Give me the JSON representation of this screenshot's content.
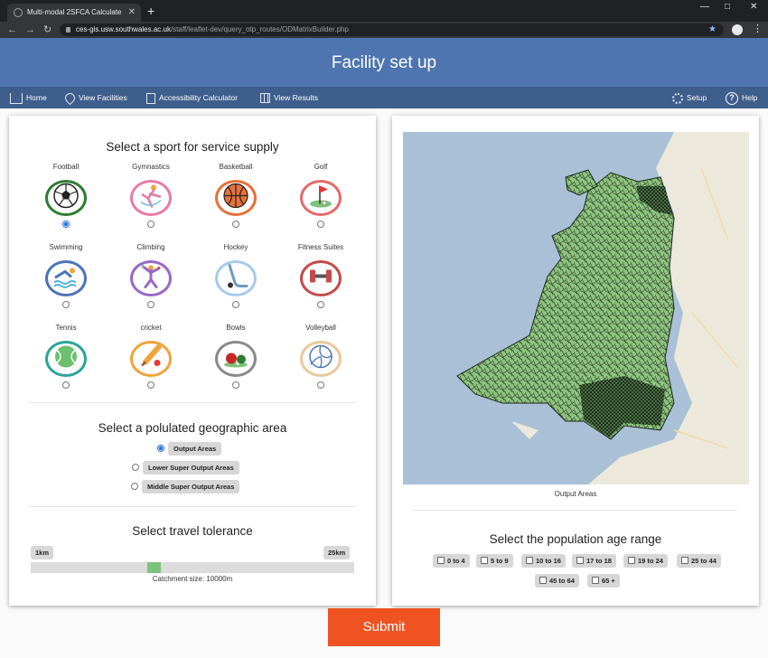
{
  "browser": {
    "tab_title": "Multi-modal 2SFCA Calculate",
    "tab_close": "✕",
    "new_tab": "+",
    "url_host": "ces-gis.usw.southwales.ac.uk",
    "url_path": "/staff/leaflet-dev/query_otp_routes/ODMatrixBuilder.php"
  },
  "header": {
    "title": "Facility set up"
  },
  "nav": {
    "home": "Home",
    "view_facilities": "View Facilities",
    "accessibility_calculator": "Accessibility Calculator",
    "view_results": "View Results",
    "setup": "Setup",
    "help": "Help"
  },
  "sport_section": {
    "title": "Select a sport for service supply",
    "sports": [
      {
        "label": "Football",
        "color": "#2e7d32",
        "icon": "football-icon",
        "checked": true
      },
      {
        "label": "Gymnastics",
        "color": "#e57aa7",
        "icon": "gymnastics-icon",
        "checked": false
      },
      {
        "label": "Basketball",
        "color": "#e8703a",
        "icon": "basketball-icon",
        "checked": false
      },
      {
        "label": "Golf",
        "color": "#e56a6a",
        "icon": "golf-icon",
        "checked": false
      },
      {
        "label": "Swimming",
        "color": "#4a74b8",
        "icon": "swimming-icon",
        "checked": false
      },
      {
        "label": "Climbing",
        "color": "#9a67c8",
        "icon": "climbing-icon",
        "checked": false
      },
      {
        "label": "Hockey",
        "color": "#a9cbe8",
        "icon": "hockey-icon",
        "checked": false
      },
      {
        "label": "Fitness Suites",
        "color": "#c44a4a",
        "icon": "dumbbell-icon",
        "checked": false
      },
      {
        "label": "Tennis",
        "color": "#2aa59a",
        "icon": "tennis-icon",
        "checked": false
      },
      {
        "label": "cricket",
        "color": "#f0a43a",
        "icon": "cricket-icon",
        "checked": false
      },
      {
        "label": "Bowls",
        "color": "#8a8a8a",
        "icon": "bowls-icon",
        "checked": false
      },
      {
        "label": "Volleyball",
        "color": "#e8c99a",
        "icon": "volleyball-icon",
        "checked": false
      }
    ]
  },
  "area_section": {
    "title": "Select a polulated geographic area",
    "options": [
      {
        "label": "Output Areas",
        "checked": true
      },
      {
        "label": "Lower Super Output Areas",
        "checked": false
      },
      {
        "label": "Middle Super Output Areas",
        "checked": false
      }
    ]
  },
  "travel_section": {
    "title": "Select travel tolerance",
    "min_label": "1km",
    "max_label": "25km",
    "value_fraction": 0.375,
    "catchment_text": "Catchment size: 10000m"
  },
  "map": {
    "caption": "Output Areas"
  },
  "age_section": {
    "title": "Select the population age range",
    "ranges": [
      "0 to 4",
      "5 to 9",
      "10 to 16",
      "17 to 18",
      "19 to 24",
      "25 to 44",
      "45 to 64",
      "65 +"
    ]
  },
  "submit_label": "Submit"
}
